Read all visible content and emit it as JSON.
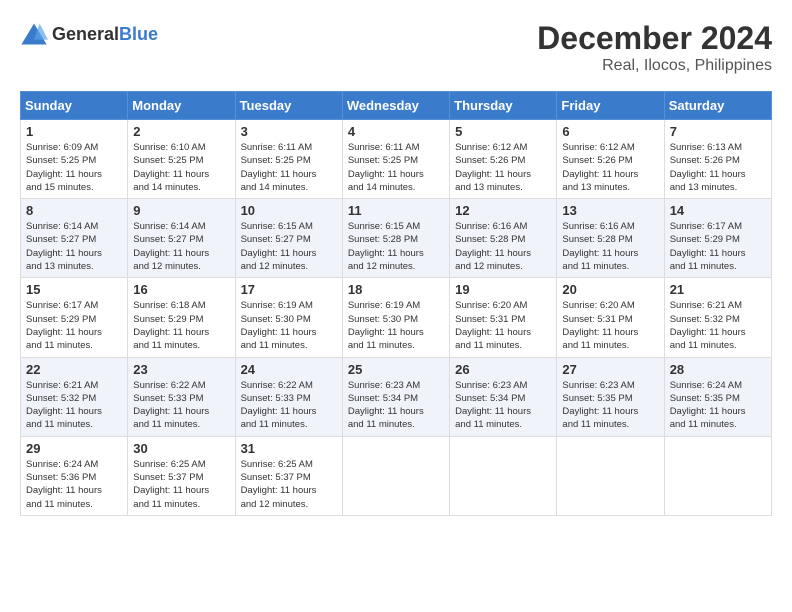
{
  "header": {
    "logo_general": "General",
    "logo_blue": "Blue",
    "month": "December 2024",
    "location": "Real, Ilocos, Philippines"
  },
  "weekdays": [
    "Sunday",
    "Monday",
    "Tuesday",
    "Wednesday",
    "Thursday",
    "Friday",
    "Saturday"
  ],
  "weeks": [
    [
      {
        "day": "1",
        "detail": "Sunrise: 6:09 AM\nSunset: 5:25 PM\nDaylight: 11 hours\nand 15 minutes."
      },
      {
        "day": "2",
        "detail": "Sunrise: 6:10 AM\nSunset: 5:25 PM\nDaylight: 11 hours\nand 14 minutes."
      },
      {
        "day": "3",
        "detail": "Sunrise: 6:11 AM\nSunset: 5:25 PM\nDaylight: 11 hours\nand 14 minutes."
      },
      {
        "day": "4",
        "detail": "Sunrise: 6:11 AM\nSunset: 5:25 PM\nDaylight: 11 hours\nand 14 minutes."
      },
      {
        "day": "5",
        "detail": "Sunrise: 6:12 AM\nSunset: 5:26 PM\nDaylight: 11 hours\nand 13 minutes."
      },
      {
        "day": "6",
        "detail": "Sunrise: 6:12 AM\nSunset: 5:26 PM\nDaylight: 11 hours\nand 13 minutes."
      },
      {
        "day": "7",
        "detail": "Sunrise: 6:13 AM\nSunset: 5:26 PM\nDaylight: 11 hours\nand 13 minutes."
      }
    ],
    [
      {
        "day": "8",
        "detail": "Sunrise: 6:14 AM\nSunset: 5:27 PM\nDaylight: 11 hours\nand 13 minutes."
      },
      {
        "day": "9",
        "detail": "Sunrise: 6:14 AM\nSunset: 5:27 PM\nDaylight: 11 hours\nand 12 minutes."
      },
      {
        "day": "10",
        "detail": "Sunrise: 6:15 AM\nSunset: 5:27 PM\nDaylight: 11 hours\nand 12 minutes."
      },
      {
        "day": "11",
        "detail": "Sunrise: 6:15 AM\nSunset: 5:28 PM\nDaylight: 11 hours\nand 12 minutes."
      },
      {
        "day": "12",
        "detail": "Sunrise: 6:16 AM\nSunset: 5:28 PM\nDaylight: 11 hours\nand 12 minutes."
      },
      {
        "day": "13",
        "detail": "Sunrise: 6:16 AM\nSunset: 5:28 PM\nDaylight: 11 hours\nand 11 minutes."
      },
      {
        "day": "14",
        "detail": "Sunrise: 6:17 AM\nSunset: 5:29 PM\nDaylight: 11 hours\nand 11 minutes."
      }
    ],
    [
      {
        "day": "15",
        "detail": "Sunrise: 6:17 AM\nSunset: 5:29 PM\nDaylight: 11 hours\nand 11 minutes."
      },
      {
        "day": "16",
        "detail": "Sunrise: 6:18 AM\nSunset: 5:29 PM\nDaylight: 11 hours\nand 11 minutes."
      },
      {
        "day": "17",
        "detail": "Sunrise: 6:19 AM\nSunset: 5:30 PM\nDaylight: 11 hours\nand 11 minutes."
      },
      {
        "day": "18",
        "detail": "Sunrise: 6:19 AM\nSunset: 5:30 PM\nDaylight: 11 hours\nand 11 minutes."
      },
      {
        "day": "19",
        "detail": "Sunrise: 6:20 AM\nSunset: 5:31 PM\nDaylight: 11 hours\nand 11 minutes."
      },
      {
        "day": "20",
        "detail": "Sunrise: 6:20 AM\nSunset: 5:31 PM\nDaylight: 11 hours\nand 11 minutes."
      },
      {
        "day": "21",
        "detail": "Sunrise: 6:21 AM\nSunset: 5:32 PM\nDaylight: 11 hours\nand 11 minutes."
      }
    ],
    [
      {
        "day": "22",
        "detail": "Sunrise: 6:21 AM\nSunset: 5:32 PM\nDaylight: 11 hours\nand 11 minutes."
      },
      {
        "day": "23",
        "detail": "Sunrise: 6:22 AM\nSunset: 5:33 PM\nDaylight: 11 hours\nand 11 minutes."
      },
      {
        "day": "24",
        "detail": "Sunrise: 6:22 AM\nSunset: 5:33 PM\nDaylight: 11 hours\nand 11 minutes."
      },
      {
        "day": "25",
        "detail": "Sunrise: 6:23 AM\nSunset: 5:34 PM\nDaylight: 11 hours\nand 11 minutes."
      },
      {
        "day": "26",
        "detail": "Sunrise: 6:23 AM\nSunset: 5:34 PM\nDaylight: 11 hours\nand 11 minutes."
      },
      {
        "day": "27",
        "detail": "Sunrise: 6:23 AM\nSunset: 5:35 PM\nDaylight: 11 hours\nand 11 minutes."
      },
      {
        "day": "28",
        "detail": "Sunrise: 6:24 AM\nSunset: 5:35 PM\nDaylight: 11 hours\nand 11 minutes."
      }
    ],
    [
      {
        "day": "29",
        "detail": "Sunrise: 6:24 AM\nSunset: 5:36 PM\nDaylight: 11 hours\nand 11 minutes."
      },
      {
        "day": "30",
        "detail": "Sunrise: 6:25 AM\nSunset: 5:37 PM\nDaylight: 11 hours\nand 11 minutes."
      },
      {
        "day": "31",
        "detail": "Sunrise: 6:25 AM\nSunset: 5:37 PM\nDaylight: 11 hours\nand 12 minutes."
      },
      {
        "day": "",
        "detail": ""
      },
      {
        "day": "",
        "detail": ""
      },
      {
        "day": "",
        "detail": ""
      },
      {
        "day": "",
        "detail": ""
      }
    ]
  ]
}
